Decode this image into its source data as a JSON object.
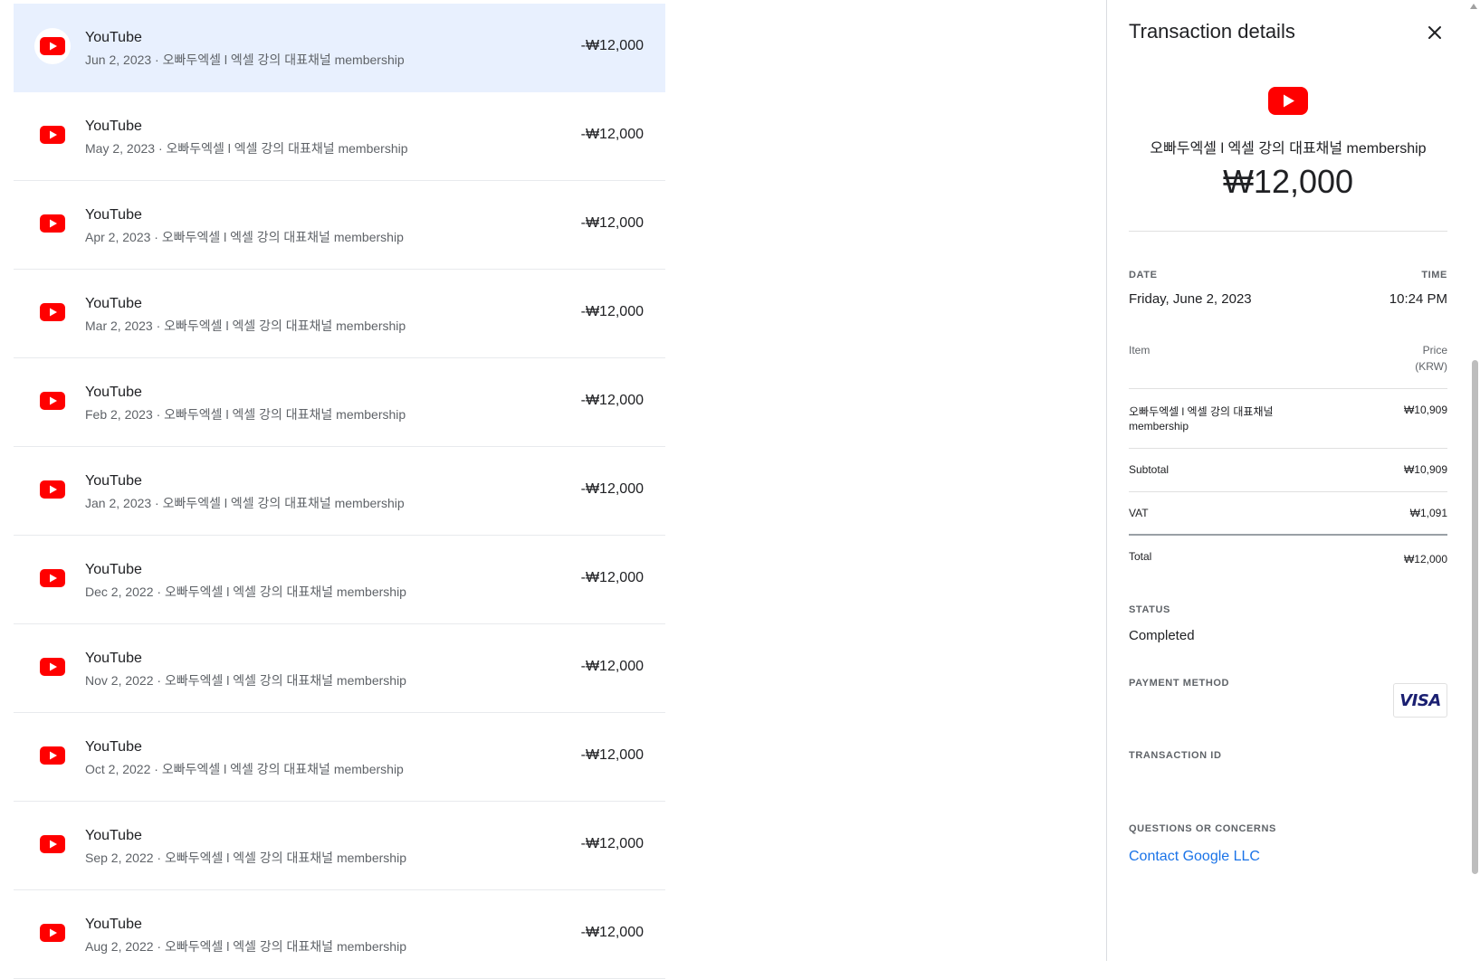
{
  "transactions": [
    {
      "merchant": "YouTube",
      "subtitle": "Jun 2, 2023 · 오빠두엑셀 l 엑셀 강의 대표채널 membership",
      "amount": "-₩12,000",
      "selected": true
    },
    {
      "merchant": "YouTube",
      "subtitle": "May 2, 2023 · 오빠두엑셀 l 엑셀 강의 대표채널 membership",
      "amount": "-₩12,000"
    },
    {
      "merchant": "YouTube",
      "subtitle": "Apr 2, 2023 · 오빠두엑셀 l 엑셀 강의 대표채널 membership",
      "amount": "-₩12,000"
    },
    {
      "merchant": "YouTube",
      "subtitle": "Mar 2, 2023 · 오빠두엑셀 l 엑셀 강의 대표채널 membership",
      "amount": "-₩12,000"
    },
    {
      "merchant": "YouTube",
      "subtitle": "Feb 2, 2023 · 오빠두엑셀 l 엑셀 강의 대표채널 membership",
      "amount": "-₩12,000"
    },
    {
      "merchant": "YouTube",
      "subtitle": "Jan 2, 2023 · 오빠두엑셀 l 엑셀 강의 대표채널 membership",
      "amount": "-₩12,000"
    },
    {
      "merchant": "YouTube",
      "subtitle": "Dec 2, 2022 · 오빠두엑셀 l 엑셀 강의 대표채널 membership",
      "amount": "-₩12,000"
    },
    {
      "merchant": "YouTube",
      "subtitle": "Nov 2, 2022 · 오빠두엑셀 l 엑셀 강의 대표채널 membership",
      "amount": "-₩12,000"
    },
    {
      "merchant": "YouTube",
      "subtitle": "Oct 2, 2022 · 오빠두엑셀 l 엑셀 강의 대표채널 membership",
      "amount": "-₩12,000"
    },
    {
      "merchant": "YouTube",
      "subtitle": "Sep 2, 2022 · 오빠두엑셀 l 엑셀 강의 대표채널 membership",
      "amount": "-₩12,000"
    },
    {
      "merchant": "YouTube",
      "subtitle": "Aug 2, 2022 · 오빠두엑셀 l 엑셀 강의 대표채널 membership",
      "amount": "-₩12,000"
    }
  ],
  "details": {
    "title": "Transaction details",
    "close_icon": "close-icon",
    "item_name": "오빠두엑셀 l 엑셀 강의 대표채널 membership",
    "amount": "₩12,000",
    "date_label": "DATE",
    "date_value": "Friday, June 2, 2023",
    "time_label": "TIME",
    "time_value": "10:24 PM",
    "item_header": "Item",
    "price_header_1": "Price",
    "price_header_2": "(KRW)",
    "line_item_1": "오빠두엑셀 l 엑셀 강의 대표채널",
    "line_item_2": "membership",
    "line_item_price": "₩10,909",
    "subtotal_label": "Subtotal",
    "subtotal_value": "₩10,909",
    "vat_label": "VAT",
    "vat_value": "₩1,091",
    "total_label": "Total",
    "total_value": "₩12,000",
    "status_label": "STATUS",
    "status_value": "Completed",
    "payment_label": "PAYMENT METHOD",
    "payment_brand": "VISA",
    "txid_label": "TRANSACTION ID",
    "questions_label": "QUESTIONS OR CONCERNS",
    "contact_link": "Contact Google LLC"
  },
  "colors": {
    "youtube_red": "#ff0000",
    "selected_bg": "#e8f0fe",
    "link": "#1a73e8",
    "visa_blue": "#1a1f71"
  }
}
